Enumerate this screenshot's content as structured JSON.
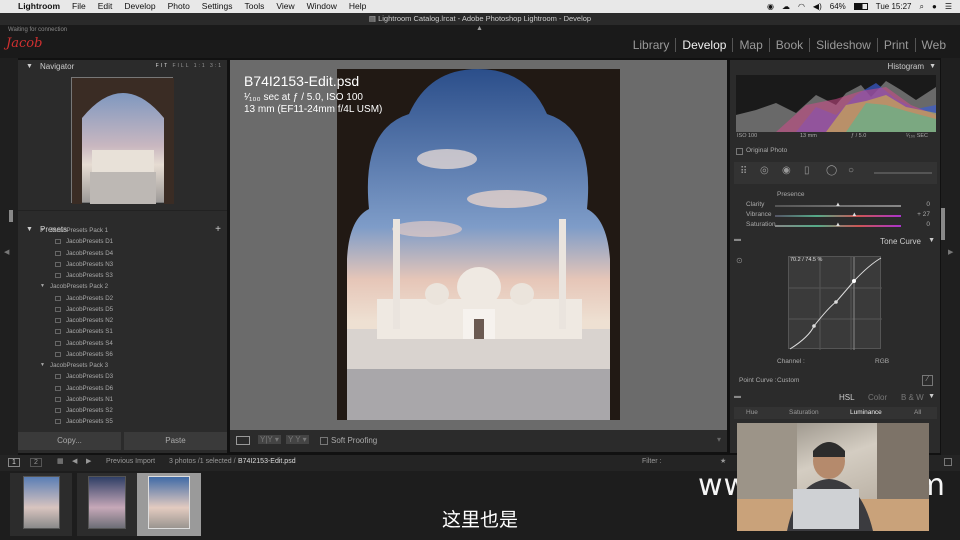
{
  "menubar": {
    "apple": "",
    "items": [
      "Lightroom",
      "File",
      "Edit",
      "Develop",
      "Photo",
      "Settings",
      "Tools",
      "View",
      "Window",
      "Help"
    ],
    "battery": "64%",
    "clock": "Tue 15:27"
  },
  "window": {
    "title": "Lightroom Catalog.lrcat - Adobe Photoshop Lightroom - Develop"
  },
  "identity": {
    "status": "Waiting for connection",
    "logo": "Jacob",
    "modules": [
      "Library",
      "Develop",
      "Map",
      "Book",
      "Slideshow",
      "Print",
      "Web"
    ],
    "active_module": "Develop"
  },
  "navigator": {
    "title": "Navigator",
    "zoom_options": [
      "FIT",
      "FILL",
      "1:1",
      "3:1"
    ]
  },
  "presets": {
    "title": "Presets",
    "add": "+",
    "packs": [
      {
        "name": "JacobPresets Pack 1",
        "items": [
          "JacobPresets D1",
          "JacobPresets D4",
          "JacobPresets N3",
          "JacobPresets S3"
        ]
      },
      {
        "name": "JacobPresets Pack 2",
        "items": [
          "JacobPresets D2",
          "JacobPresets D5",
          "JacobPresets N2",
          "JacobPresets S1",
          "JacobPresets S4",
          "JacobPresets S6"
        ]
      },
      {
        "name": "JacobPresets Pack 3",
        "items": [
          "JacobPresets D3",
          "JacobPresets D6",
          "JacobPresets N1",
          "JacobPresets S2",
          "JacobPresets S5"
        ]
      }
    ]
  },
  "left_buttons": {
    "copy": "Copy...",
    "paste": "Paste"
  },
  "photo_info": {
    "filename": "B74I2153-Edit.psd",
    "exposure": "¹⁄₁₀₀ sec at ƒ / 5.0, ISO 100",
    "lens": "13 mm (EF11-24mm f/4L USM)"
  },
  "toolbar": {
    "soft_proofing": "Soft Proofing"
  },
  "histogram": {
    "title": "Histogram",
    "iso": "ISO 100",
    "focal": "13 mm",
    "aperture": "ƒ / 5.0",
    "shutter": "¹⁄₁₀₀ SEC",
    "original_photo": "Original Photo"
  },
  "presence": {
    "title": "Presence",
    "rows": [
      {
        "label": "Clarity",
        "value": "0",
        "level": 0.5
      },
      {
        "label": "Vibrance",
        "value": "+ 27",
        "level": 0.63
      },
      {
        "label": "Saturation",
        "value": "0",
        "level": 0.5
      }
    ]
  },
  "tone_curve": {
    "title": "Tone Curve",
    "readout": "70.2 / 74.5 %",
    "channel_label": "Channel :",
    "channel_value": "RGB",
    "point_curve_label": "Point Curve :",
    "point_curve_value": "Custom"
  },
  "hsl": {
    "tabs": [
      "HSL",
      "Color",
      "B & W"
    ],
    "subtabs": [
      "Hue",
      "Saturation",
      "Luminance",
      "All"
    ],
    "active_subtab": "Luminance"
  },
  "filmstrip_bar": {
    "pages": [
      "1",
      "2"
    ],
    "source": "Previous Import",
    "count": "3 photos /1 selected /",
    "selected_file": "B74I2153-Edit.psd",
    "filter": "Filter :"
  },
  "overlay": {
    "subtitle": "这里也是",
    "watermark": "www.hunls.com"
  },
  "colors": {
    "accent": "#f0f0f0",
    "panel": "#2b2b2b",
    "canvas": "#6b6b6b"
  }
}
